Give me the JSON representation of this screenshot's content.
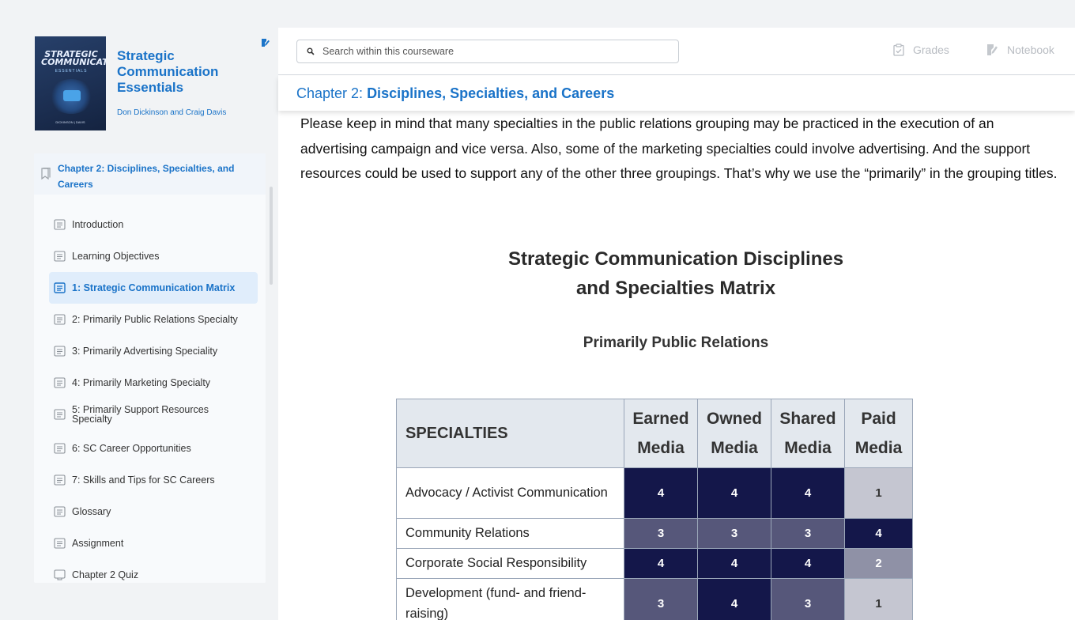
{
  "book": {
    "cover_title": "STRATEGIC COMMUNICATION",
    "cover_subtitle": "ESSENTIALS",
    "cover_authors": "DICKINSON | DAVIS",
    "title": "Strategic Communication Essentials",
    "authors": "Don Dickinson and Craig Davis"
  },
  "toc": {
    "chapter": "Chapter 2: Disciplines, Specialties, and Careers",
    "items": [
      {
        "label": "Introduction",
        "icon": "page-icon"
      },
      {
        "label": "Learning Objectives",
        "icon": "page-icon"
      },
      {
        "label": "1: Strategic Communication Matrix",
        "icon": "page-icon",
        "active": true
      },
      {
        "label": "2: Primarily Public Relations Specialty",
        "icon": "page-icon"
      },
      {
        "label": "3: Primarily Advertising Speciality",
        "icon": "page-icon"
      },
      {
        "label": "4: Primarily Marketing Specialty",
        "icon": "page-icon"
      },
      {
        "label": "5: Primarily Support Resources Specialty",
        "icon": "page-icon"
      },
      {
        "label": "6: SC Career Opportunities",
        "icon": "page-icon"
      },
      {
        "label": "7: Skills and Tips for SC Careers",
        "icon": "page-icon"
      },
      {
        "label": "Glossary",
        "icon": "page-icon"
      },
      {
        "label": "Assignment",
        "icon": "page-icon"
      },
      {
        "label": "Chapter 2 Quiz",
        "icon": "quiz-icon"
      }
    ]
  },
  "topbar": {
    "search_placeholder": "Search within this courseware",
    "grades_label": "Grades",
    "notebook_label": "Notebook"
  },
  "chapter_bar": {
    "prefix": "Chapter 2: ",
    "title": "Disciplines, Specialties, and Careers"
  },
  "content": {
    "paragraph": "Please keep in mind that many specialties in the public relations grouping may be practiced in the execution of an advertising campaign and vice versa. Also, some of the marketing specialties could involve advertising. And the support resources could be used to support any of the other three groupings. That’s why we use the “primarily” in the grouping titles.",
    "matrix_title_line1": "Strategic Communication Disciplines",
    "matrix_title_line2": "and Specialties Matrix",
    "matrix_subtitle": "Primarily Public Relations"
  },
  "matrix": {
    "header": {
      "specialties": "SPECIALTIES",
      "earned_1": "Earned",
      "earned_2": "Media",
      "owned_1": "Owned",
      "owned_2": "Media",
      "shared_1": "Shared",
      "shared_2": "Media",
      "paid_1": "Paid",
      "paid_2": "Media"
    },
    "rows": [
      {
        "name": "Advocacy / Activist Communication",
        "earned": "4",
        "owned": "4",
        "shared": "4",
        "paid": "1"
      },
      {
        "name": "Community Relations",
        "earned": "3",
        "owned": "3",
        "shared": "3",
        "paid": "4"
      },
      {
        "name": "Corporate Social Responsibility",
        "earned": "4",
        "owned": "4",
        "shared": "4",
        "paid": "2"
      },
      {
        "name": "Development (fund- and friend-raising)",
        "earned": "3",
        "owned": "4",
        "shared": "3",
        "paid": "1"
      }
    ]
  }
}
